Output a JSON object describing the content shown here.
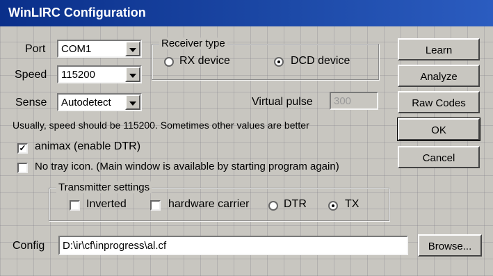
{
  "window": {
    "title": "WinLIRC Configuration"
  },
  "form": {
    "port": {
      "label": "Port",
      "value": "COM1"
    },
    "speed": {
      "label": "Speed",
      "value": "115200"
    },
    "sense": {
      "label": "Sense",
      "value": "Autodetect"
    },
    "virtual_pulse": {
      "label": "Virtual pulse",
      "value": "300"
    },
    "note": "Usually, speed should be 115200. Sometimes other values are better",
    "animax": {
      "label": "animax (enable DTR)",
      "checked": true
    },
    "no_tray": {
      "label": "No tray icon. (Main window is available by starting program again)",
      "checked": false
    },
    "config": {
      "label": "Config",
      "value": "D:\\ir\\cf\\inprogress\\al.cf"
    }
  },
  "receiver": {
    "title": "Receiver type",
    "options": [
      {
        "label": "RX device",
        "selected": false
      },
      {
        "label": "DCD device",
        "selected": true
      }
    ]
  },
  "transmitter": {
    "title": "Transmitter settings",
    "inverted": {
      "label": "Inverted",
      "checked": false
    },
    "hardware_carrier": {
      "label": "hardware carrier",
      "checked": false
    },
    "dtr": {
      "label": "DTR",
      "selected": false
    },
    "tx": {
      "label": "TX",
      "selected": true
    }
  },
  "buttons": {
    "learn": "Learn",
    "analyze": "Analyze",
    "raw_codes": "Raw Codes",
    "ok": "OK",
    "cancel": "Cancel",
    "browse": "Browse..."
  },
  "colors": {
    "titlebar": "#0a2f8a",
    "face": "#c8c6c0"
  }
}
